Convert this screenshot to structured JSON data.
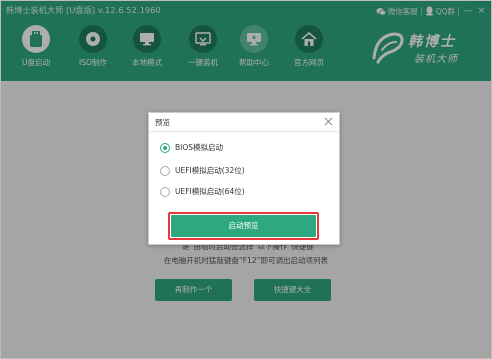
{
  "app": {
    "title": "韩博士装机大师 [U盘版] v.12.6.52.1960",
    "top_links": {
      "wechat": "微信客服",
      "qq": "QQ群"
    },
    "window_buttons": {
      "minimize": "—",
      "close": "×"
    }
  },
  "nav": [
    {
      "label": "U盘启动",
      "icon": "usb-drive-icon"
    },
    {
      "label": "ISO制作",
      "icon": "disc-icon"
    },
    {
      "label": "本地模式",
      "icon": "monitor-icon"
    },
    {
      "label": "一键装机",
      "icon": "install-icon"
    },
    {
      "label": "帮助中心",
      "icon": "help-icon"
    },
    {
      "label": "官方网页",
      "icon": "home-icon"
    }
  ],
  "logo": {
    "line1": "韩博士",
    "line2": "装机大师"
  },
  "background": {
    "line1": "“是”由临时启动会选择“以下操作”快捷键",
    "line2": "在电脑开机时猛敲键盘“F12”即可调出启动项列表",
    "btn_left": "再制作一个",
    "btn_right": "快捷键大全"
  },
  "dialog": {
    "title": "预览",
    "options": [
      {
        "label": "BIOS模拟启动",
        "checked": true
      },
      {
        "label": "UEFI模拟启动(32位)",
        "checked": false
      },
      {
        "label": "UEFI模拟启动(64位)",
        "checked": false
      }
    ],
    "start_button": "启动预览"
  },
  "colors": {
    "brand": "#2ea881",
    "highlight": "#e53a3a"
  }
}
